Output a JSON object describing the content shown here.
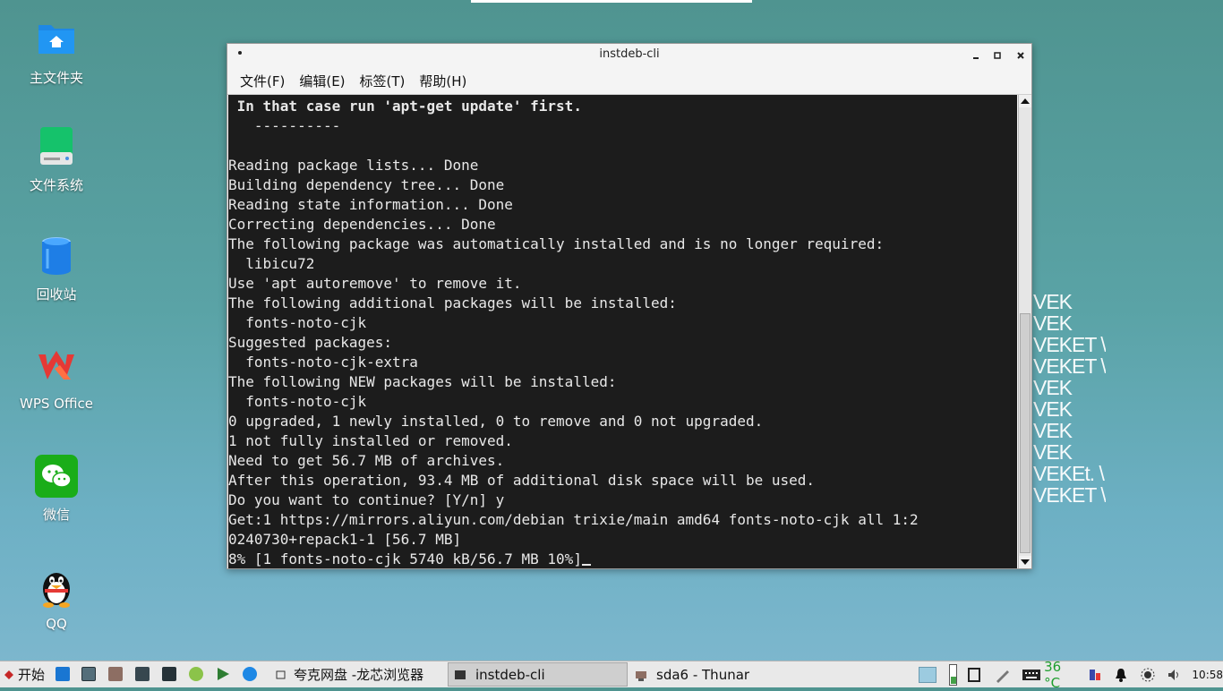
{
  "desktop": {
    "icons": [
      {
        "label": "主文件夹",
        "icon": "folder-icon"
      },
      {
        "label": "文件系统",
        "icon": "drive-icon"
      },
      {
        "label": "回收站",
        "icon": "trash-icon"
      },
      {
        "label": "WPS Office",
        "icon": "wps-icon"
      },
      {
        "label": "微信",
        "icon": "wechat-icon"
      },
      {
        "label": "QQ",
        "icon": "qq-icon"
      }
    ],
    "watermark_lines": [
      "VEK",
      "VEK",
      "VEKET \\",
      "VEKET \\",
      "VEK",
      "VEK",
      "VEK",
      "VEK",
      "VEKEt. \\",
      "VEKET \\"
    ]
  },
  "window": {
    "title": "instdeb-cli",
    "menu": [
      "文件(F)",
      "编辑(E)",
      "标签(T)",
      "帮助(H)"
    ],
    "terminal": {
      "header_line": " In that case run 'apt-get update' first.",
      "separator_line": "   ----------",
      "lines": [
        "",
        "Reading package lists... Done",
        "Building dependency tree... Done",
        "Reading state information... Done",
        "Correcting dependencies... Done",
        "The following package was automatically installed and is no longer required:",
        "  libicu72",
        "Use 'apt autoremove' to remove it.",
        "The following additional packages will be installed:",
        "  fonts-noto-cjk",
        "Suggested packages:",
        "  fonts-noto-cjk-extra",
        "The following NEW packages will be installed:",
        "  fonts-noto-cjk",
        "0 upgraded, 1 newly installed, 0 to remove and 0 not upgraded.",
        "1 not fully installed or removed.",
        "Need to get 56.7 MB of archives.",
        "After this operation, 93.4 MB of additional disk space will be used.",
        "Do you want to continue? [Y/n] y",
        "Get:1 https://mirrors.aliyun.com/debian trixie/main amd64 fonts-noto-cjk all 1:2",
        "0240730+repack1-1 [56.7 MB]"
      ],
      "prompt_line": "8% [1 fonts-noto-cjk 5740 kB/56.7 MB 10%]"
    }
  },
  "taskbar": {
    "start_label": "开始",
    "tasks": [
      {
        "label": "夸克网盘 -龙芯浏览器",
        "active": false
      },
      {
        "label": "instdeb-cli",
        "active": true
      },
      {
        "label": "sda6 - Thunar",
        "active": false
      }
    ],
    "temperature": "36 °C",
    "clock": "10:58"
  }
}
